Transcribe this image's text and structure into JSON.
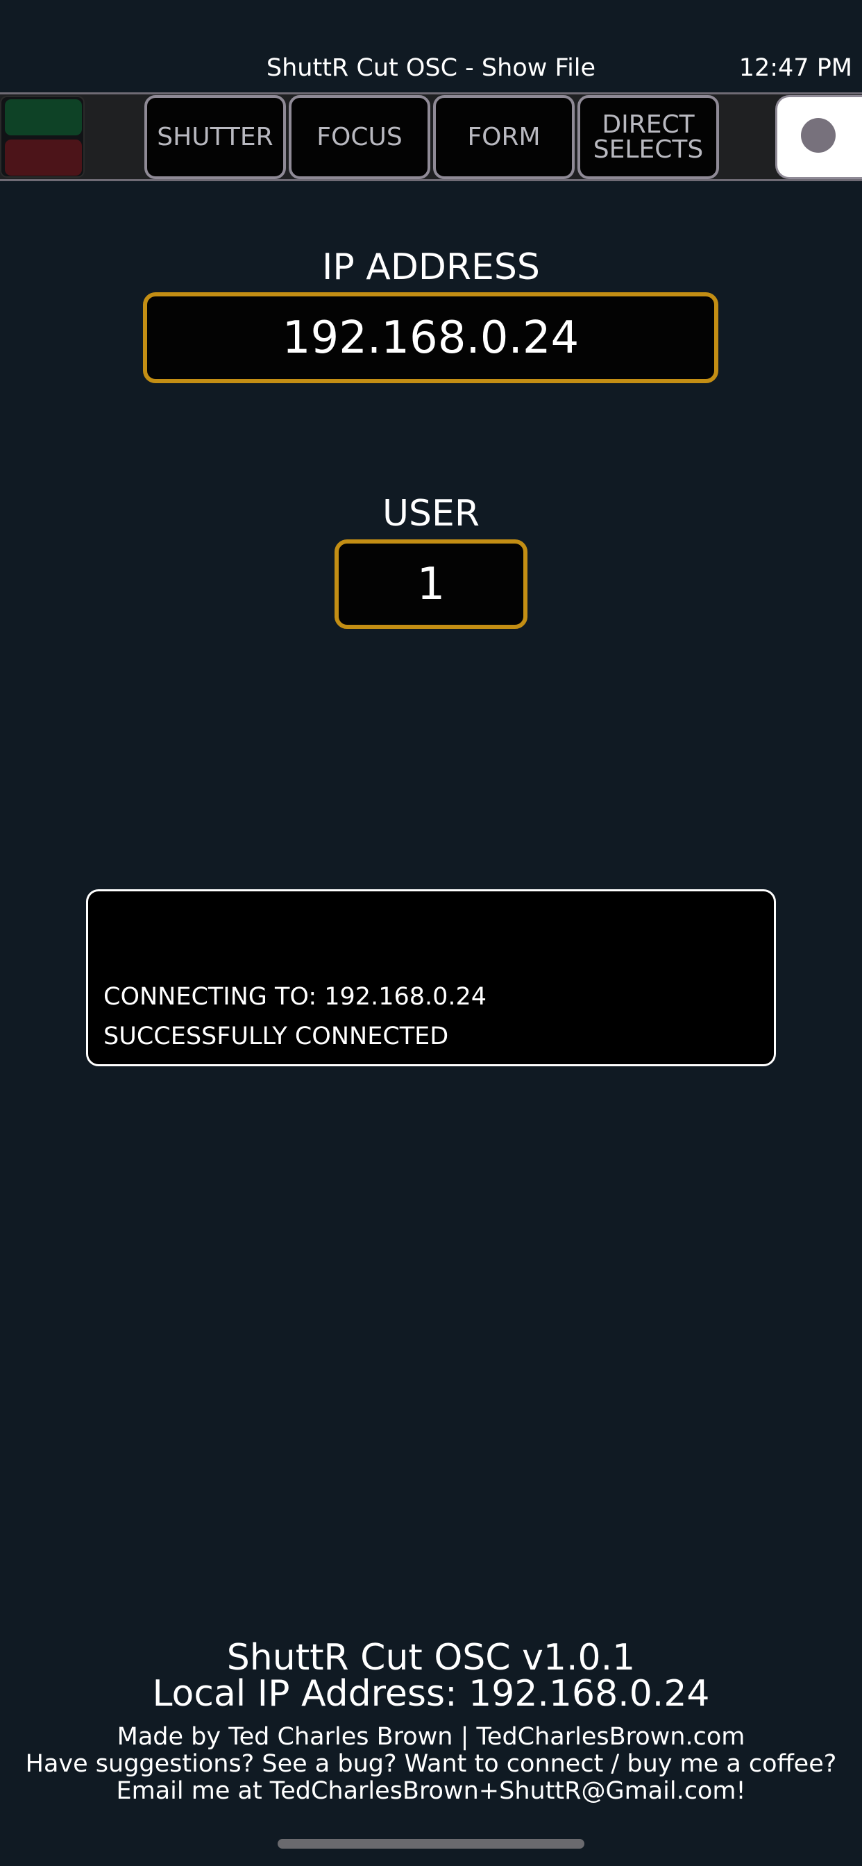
{
  "header": {
    "title": "ShuttR Cut OSC - Show File",
    "time": "12:47 PM"
  },
  "toolbar": {
    "status_colors": {
      "connected": "#0e4226",
      "error": "#4c1419"
    },
    "tabs": [
      {
        "label": "SHUTTER"
      },
      {
        "label": "FOCUS"
      },
      {
        "label": "FORM"
      },
      {
        "label_line1": "DIRECT",
        "label_line2": "SELECTS"
      }
    ],
    "record_icon": "record-circle-icon"
  },
  "ip_field": {
    "label": "IP ADDRESS",
    "value": "192.168.0.24"
  },
  "user_field": {
    "label": "USER",
    "value": "1"
  },
  "log": {
    "lines": [
      "CONNECTING TO: 192.168.0.24",
      "SUCCESSFULLY CONNECTED"
    ]
  },
  "footer": {
    "version": "ShuttR Cut OSC v1.0.1",
    "local_ip": "Local IP Address: 192.168.0.24",
    "credit": "Made by Ted Charles Brown | TedCharlesBrown.com",
    "suggestions": "Have suggestions? See a bug? Want to connect / buy me a coffee?",
    "email": "Email me at TedCharlesBrown+ShuttR@Gmail.com!"
  },
  "colors": {
    "background": "#101a23",
    "accent": "#c38e14",
    "tab_border": "#8f8a96"
  }
}
